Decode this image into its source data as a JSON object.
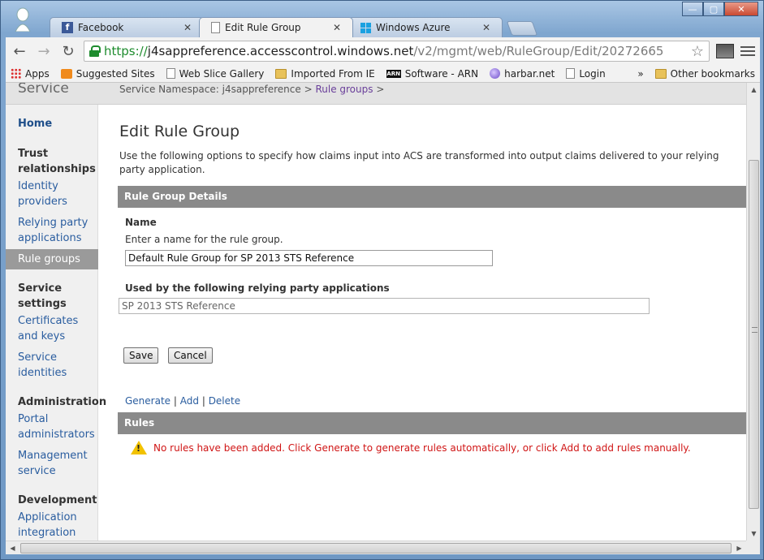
{
  "browser": {
    "tabs": [
      {
        "title": "Facebook",
        "icon": "facebook-icon"
      },
      {
        "title": "Edit Rule Group",
        "icon": "page-icon",
        "active": true
      },
      {
        "title": "Windows Azure",
        "icon": "windows-icon"
      }
    ],
    "url": {
      "protocol": "https://",
      "host": "j4sappreference.accesscontrol.windows.net",
      "path": "/v2/mgmt/web/RuleGroup/Edit/20272665"
    },
    "bookmarks": [
      {
        "label": "Apps",
        "icon": "apps-icon"
      },
      {
        "label": "Suggested Sites",
        "icon": "suggested-sites-icon"
      },
      {
        "label": "Web Slice Gallery",
        "icon": "page-icon"
      },
      {
        "label": "Imported From IE",
        "icon": "folder-icon"
      },
      {
        "label": "Software - ARN",
        "icon": "arn-icon"
      },
      {
        "label": "harbar.net",
        "icon": "globe-icon"
      },
      {
        "label": "Login",
        "icon": "page-icon"
      }
    ],
    "bookmarks_overflow": "»",
    "other_bookmarks": "Other bookmarks"
  },
  "header": {
    "service_label": "Service",
    "breadcrumb": {
      "namespace": "Service Namespace: j4sappreference",
      "sep1": ">",
      "link": "Rule groups",
      "sep2": ">"
    }
  },
  "sidebar": {
    "home": "Home",
    "trust_heading": "Trust relationships",
    "identity_providers": "Identity providers",
    "relying_party": "Relying party applications",
    "rule_groups": "Rule groups",
    "service_heading": "Service settings",
    "certificates": "Certificates and keys",
    "service_identities": "Service identities",
    "admin_heading": "Administration",
    "portal_admins": "Portal administrators",
    "mgmt_service": "Management service",
    "dev_heading": "Development",
    "app_integration": "Application integration"
  },
  "main": {
    "title": "Edit Rule Group",
    "intro": "Use the following options to specify how claims input into ACS are transformed into output claims delivered to your relying party application.",
    "details_heading": "Rule Group Details",
    "name_label": "Name",
    "name_hint": "Enter a name for the rule group.",
    "name_value": "Default Rule Group for SP 2013 STS Reference",
    "rp_label": "Used by the following relying party applications",
    "rp_value": "SP 2013 STS Reference",
    "save_label": "Save",
    "cancel_label": "Cancel",
    "actions": {
      "generate": "Generate",
      "sep1": "|",
      "add": "Add",
      "sep2": "|",
      "delete": "Delete"
    },
    "rules_heading": "Rules",
    "warning": "No rules have been added. Click Generate to generate rules automatically, or click Add to add rules manually."
  },
  "colors": {
    "section_bar": "#8a8a8a",
    "link": "#2a5d9f",
    "warning_text": "#d01515",
    "selected_nav": "#9a9a9a"
  }
}
